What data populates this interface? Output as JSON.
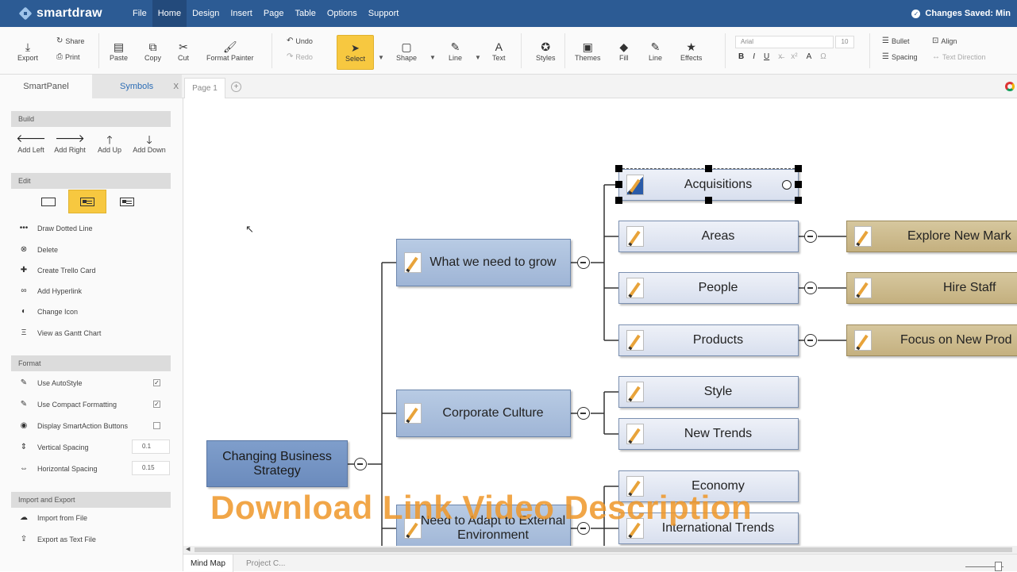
{
  "app": {
    "logo_text": "smartdraw",
    "menu": [
      "File",
      "Home",
      "Design",
      "Insert",
      "Page",
      "Table",
      "Options",
      "Support"
    ],
    "active_menu": "Home",
    "saved_status": "Changes Saved: Min"
  },
  "ribbon": {
    "export": "Export",
    "share": "Share",
    "print": "Print",
    "paste": "Paste",
    "copy": "Copy",
    "cut": "Cut",
    "format_painter": "Format Painter",
    "undo": "Undo",
    "redo": "Redo",
    "select": "Select",
    "shape": "Shape",
    "line": "Line",
    "text": "Text",
    "styles": "Styles",
    "themes": "Themes",
    "fill": "Fill",
    "line2": "Line",
    "effects": "Effects",
    "font": "Arial",
    "font_size": "10",
    "bold": "B",
    "italic": "I",
    "underline": "U",
    "strike": "x̶",
    "superscript": "x²",
    "font_color": "A",
    "symbol": "Ω",
    "bullet": "Bullet",
    "align": "Align",
    "spacing": "Spacing",
    "text_direction": "Text Direction"
  },
  "tabs": {
    "smartpanel": "SmartPanel",
    "symbols": "Symbols",
    "close": "X",
    "page": "Page 1",
    "add_page": "+"
  },
  "panel": {
    "build_head": "Build",
    "build": [
      "Add Left",
      "Add Right",
      "Add Up",
      "Add Down"
    ],
    "edit_head": "Edit",
    "actions": [
      "Draw Dotted Line",
      "Delete",
      "Create Trello Card",
      "Add Hyperlink",
      "Change Icon",
      "View as Gantt Chart"
    ],
    "format_head": "Format",
    "format": [
      "Use AutoStyle",
      "Use Compact Formatting",
      "Display SmartAction Buttons",
      "Vertical Spacing",
      "Horizontal Spacing"
    ],
    "use_autostyle": true,
    "use_compact": true,
    "display_smartaction": false,
    "vertical_spacing": "0.1",
    "horizontal_spacing": "0.15",
    "import_head": "Import and Export",
    "import_items": [
      "Import from File",
      "Export as Text File"
    ]
  },
  "mindmap": {
    "root": "Changing Business Strategy",
    "branches": [
      "What we need to grow",
      "Corporate Culture",
      "Need to Adapt to External Environment"
    ],
    "grow_children": [
      "Acquisitions",
      "Areas",
      "People",
      "Products"
    ],
    "culture_children": [
      "Style",
      "New Trends"
    ],
    "adapt_children": [
      "Economy",
      "International Trends"
    ],
    "tan_nodes": [
      "Explore New Mark",
      "Hire Staff",
      "Focus on New Prod"
    ]
  },
  "watermark": "Download Link Video Description",
  "bottom_tabs": [
    "Mind Map",
    "Project C..."
  ]
}
